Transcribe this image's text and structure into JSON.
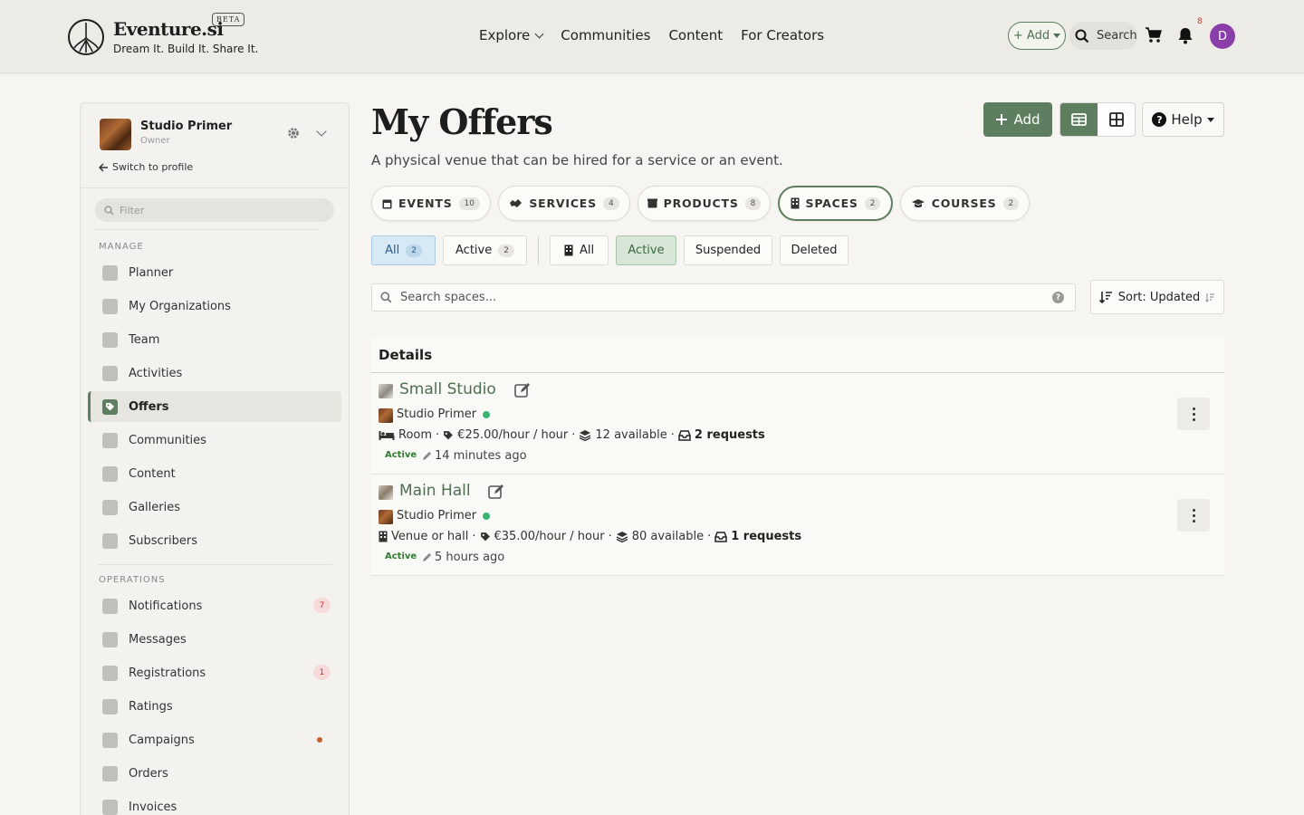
{
  "colors": {
    "brand_green": "#5e7f5f",
    "avatar_purple": "#8a3fa8",
    "status_green": "#3cb371",
    "badge_red": "#b23a3a"
  },
  "header": {
    "brand": "Eventure.si",
    "beta": "BETA",
    "tagline": "Dream It. Build It. Share It.",
    "nav": [
      "Explore",
      "Communities",
      "Content",
      "For Creators"
    ],
    "add_label": "+ Add",
    "search_label": "Search",
    "notification_count": "8",
    "avatar_letter": "D"
  },
  "sidebar": {
    "org_name": "Studio Primer",
    "org_role": "Owner",
    "switch_profile": "Switch to profile",
    "filter_placeholder": "Filter",
    "manage_label": "MANAGE",
    "operations_label": "OPERATIONS",
    "manage_items": [
      {
        "label": "Planner",
        "icon": "calendar-icon"
      },
      {
        "label": "My Organizations",
        "icon": "building-icon"
      },
      {
        "label": "Team",
        "icon": "team-icon"
      },
      {
        "label": "Activities",
        "icon": "running-icon"
      },
      {
        "label": "Offers",
        "icon": "tag-icon",
        "active": true
      },
      {
        "label": "Communities",
        "icon": "people-icon"
      },
      {
        "label": "Content",
        "icon": "newspaper-icon"
      },
      {
        "label": "Galleries",
        "icon": "image-icon"
      },
      {
        "label": "Subscribers",
        "icon": "envelope-icon"
      }
    ],
    "operation_items": [
      {
        "label": "Notifications",
        "icon": "bell-icon",
        "badge": "7"
      },
      {
        "label": "Messages",
        "icon": "envelope-icon"
      },
      {
        "label": "Registrations",
        "icon": "user-check-icon",
        "badge": "1"
      },
      {
        "label": "Ratings",
        "icon": "star-icon"
      },
      {
        "label": "Campaigns",
        "icon": "megaphone-icon",
        "dot": true
      },
      {
        "label": "Orders",
        "icon": "bag-icon"
      },
      {
        "label": "Invoices",
        "icon": "invoice-icon"
      }
    ]
  },
  "main": {
    "title": "My Offers",
    "subtitle": "A physical venue that can be hired for a service or an event.",
    "add_button": "Add",
    "help_button": "Help",
    "type_tabs": [
      {
        "label": "EVENTS",
        "count": "10",
        "icon": "calendar-icon"
      },
      {
        "label": "SERVICES",
        "count": "4",
        "icon": "handshake-icon"
      },
      {
        "label": "PRODUCTS",
        "count": "8",
        "icon": "box-icon"
      },
      {
        "label": "SPACES",
        "count": "2",
        "icon": "building-icon",
        "active": true
      },
      {
        "label": "COURSES",
        "count": "2",
        "icon": "graduation-cap-icon"
      }
    ],
    "filters": {
      "all_label": "All",
      "all_count": "2",
      "active_label": "Active",
      "active_count": "2",
      "org_all": "All",
      "org_active": "Active",
      "suspended": "Suspended",
      "deleted": "Deleted"
    },
    "search_placeholder": "Search spaces...",
    "sort_label": "Sort: Updated",
    "table_header": "Details",
    "rows": [
      {
        "title": "Small Studio",
        "org": "Studio Primer",
        "type": "Room",
        "price": "€25.00/hour / hour",
        "available": "12 available",
        "requests": "2 requests",
        "status": "Active",
        "updated": "14 minutes ago"
      },
      {
        "title": "Main Hall",
        "org": "Studio Primer",
        "type": "Venue or hall",
        "price": "€35.00/hour / hour",
        "available": "80 available",
        "requests": "1 requests",
        "status": "Active",
        "updated": "5 hours ago"
      }
    ]
  }
}
